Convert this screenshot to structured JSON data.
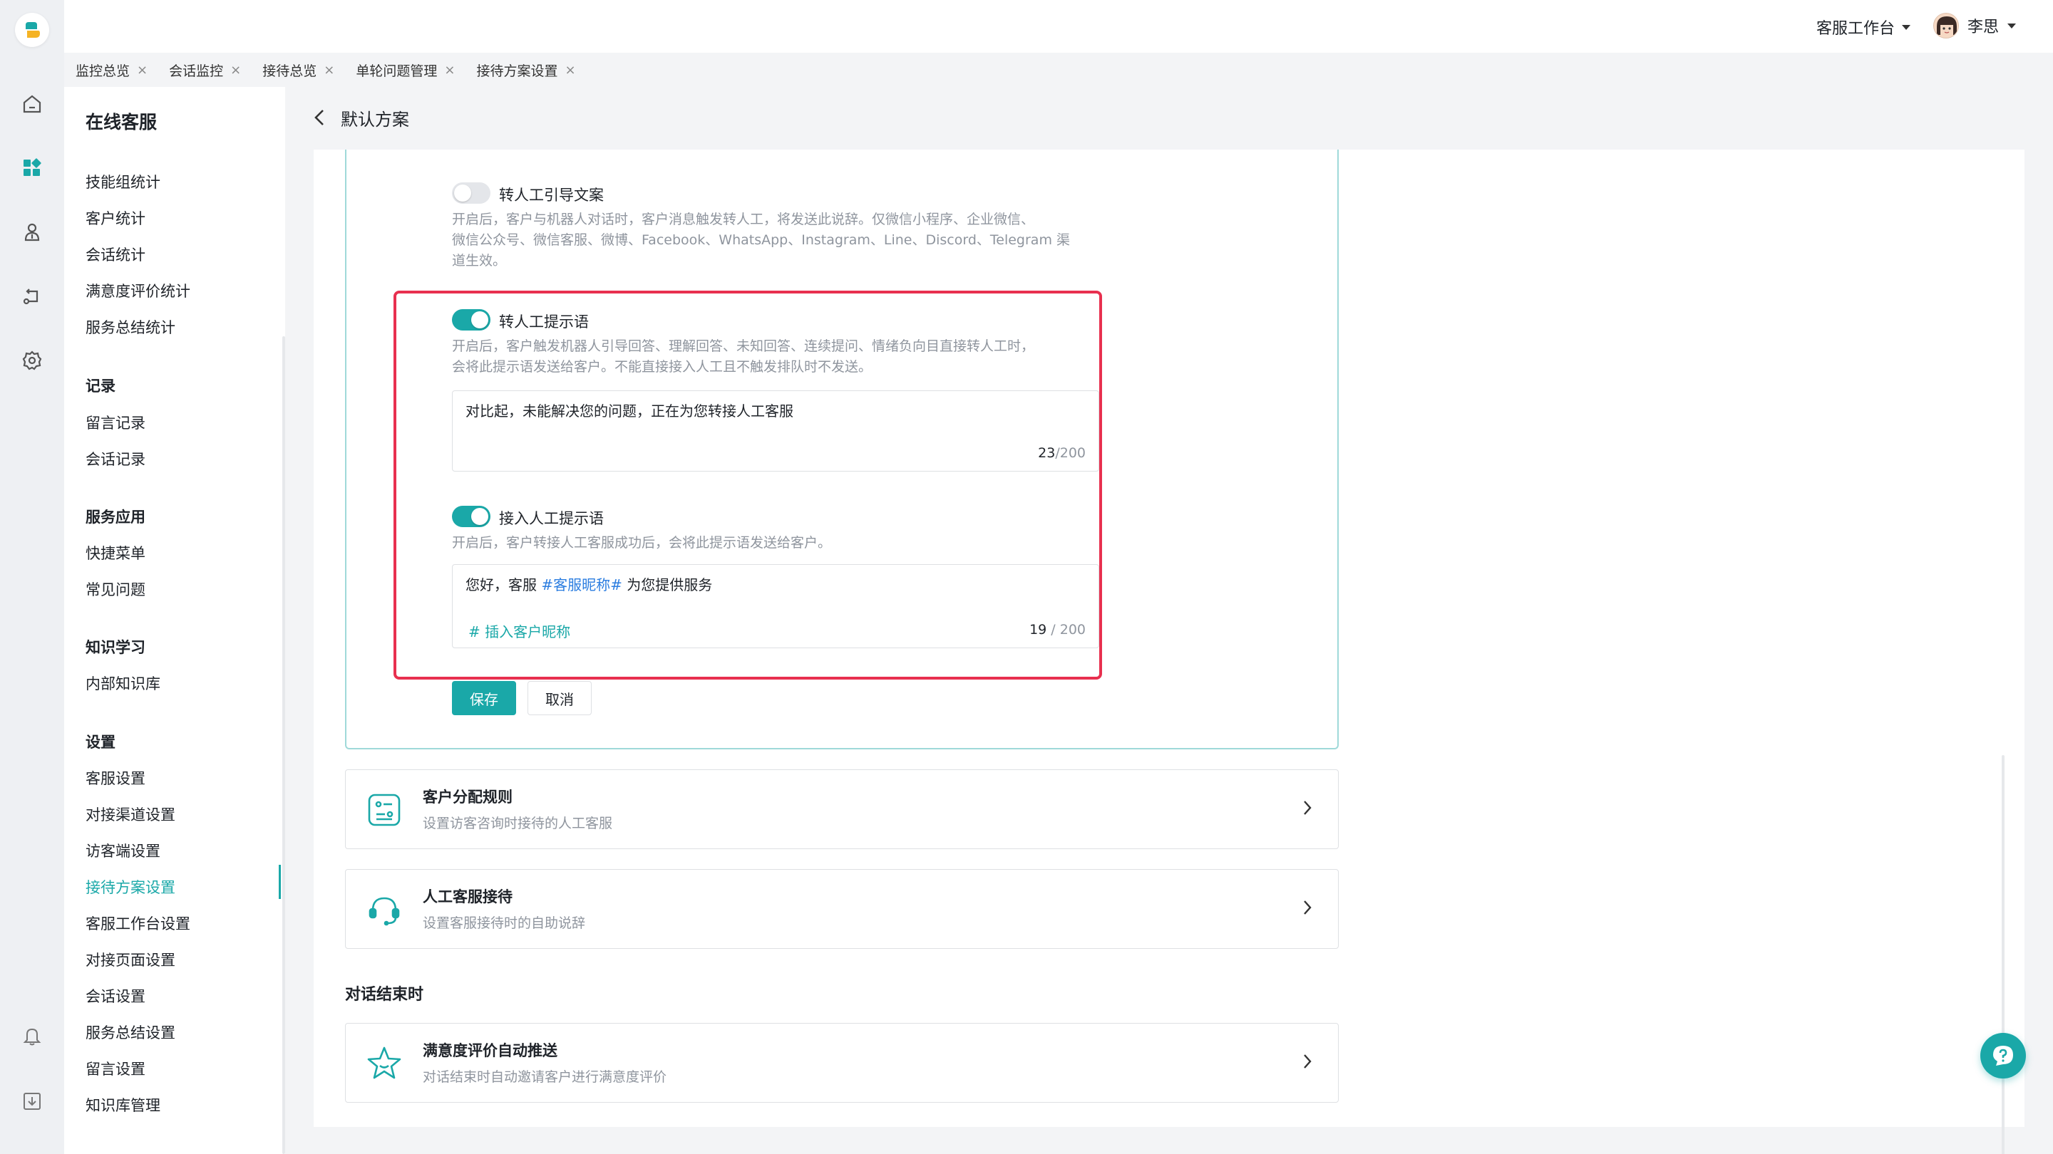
{
  "header": {
    "workbench_label": "客服工作台",
    "user_name": "李思"
  },
  "tabs": [
    {
      "label": "监控总览"
    },
    {
      "label": "会话监控"
    },
    {
      "label": "接待总览"
    },
    {
      "label": "单轮问题管理"
    },
    {
      "label": "接待方案设置"
    }
  ],
  "sidebar": {
    "title": "在线客服",
    "items_stats": [
      "技能组统计",
      "客户统计",
      "会话统计",
      "满意度评价统计",
      "服务总结统计"
    ],
    "group_records": "记录",
    "items_records": [
      "留言记录",
      "会话记录"
    ],
    "group_apps": "服务应用",
    "items_apps": [
      "快捷菜单",
      "常见问题"
    ],
    "group_learning": "知识学习",
    "items_learning": [
      "内部知识库"
    ],
    "group_settings": "设置",
    "items_settings": [
      "客服设置",
      "对接渠道设置",
      "访客端设置",
      "接待方案设置",
      "客服工作台设置",
      "对接页面设置",
      "会话设置",
      "服务总结设置",
      "留言设置",
      "知识库管理"
    ]
  },
  "page": {
    "title": "默认方案"
  },
  "transfer_guide": {
    "label": "转人工引导文案",
    "enabled": false,
    "desc_line1": "开启后，客户与机器人对话时，客户消息触发转人工，将发送此说辞。仅微信小程序、企业微信、",
    "desc_line2": "微信公众号、微信客服、微博、Facebook、WhatsApp、Instagram、Line、Discord、Telegram 渠",
    "desc_line3": "道生效。"
  },
  "transfer_prompt": {
    "label": "转人工提示语",
    "enabled": true,
    "desc_line1": "开启后，客户触发机器人引导回答、理解回答、未知回答、连续提问、情绪负向目直接转人工时，",
    "desc_line2": "会将此提示语发送给客户。不能直接接入人工且不触发排队时不发送。",
    "value": "对比起，未能解决您的问题，正在为您转接人工客服",
    "count": "23",
    "max": "/200"
  },
  "connect_prompt": {
    "label": "接入人工提示语",
    "enabled": true,
    "desc": "开启后，客户转接人工客服成功后，会将此提示语发送给客户。",
    "value_pre": "您好，客服 ",
    "value_tag": "#客服昵称#",
    "value_post": " 为您提供服务",
    "insert_label": "# 插入客户昵称",
    "count": "19",
    "max": " / 200"
  },
  "buttons": {
    "save": "保存",
    "cancel": "取消"
  },
  "rows": [
    {
      "title": "客户分配规则",
      "subtitle": "设置访客咨询时接待的人工客服",
      "icon": "distribution-icon"
    },
    {
      "title": "人工客服接待",
      "subtitle": "设置客服接待时的自助说辞",
      "icon": "headset-icon"
    }
  ],
  "section_end": "对话结束时",
  "end_rows": [
    {
      "title": "满意度评价自动推送",
      "subtitle": "对话结束时自动邀请客户进行满意度评价",
      "icon": "star-icon"
    }
  ],
  "colors": {
    "accent": "#1aa8a8",
    "highlight_border": "#e8304f",
    "link": "#2b7de0"
  }
}
